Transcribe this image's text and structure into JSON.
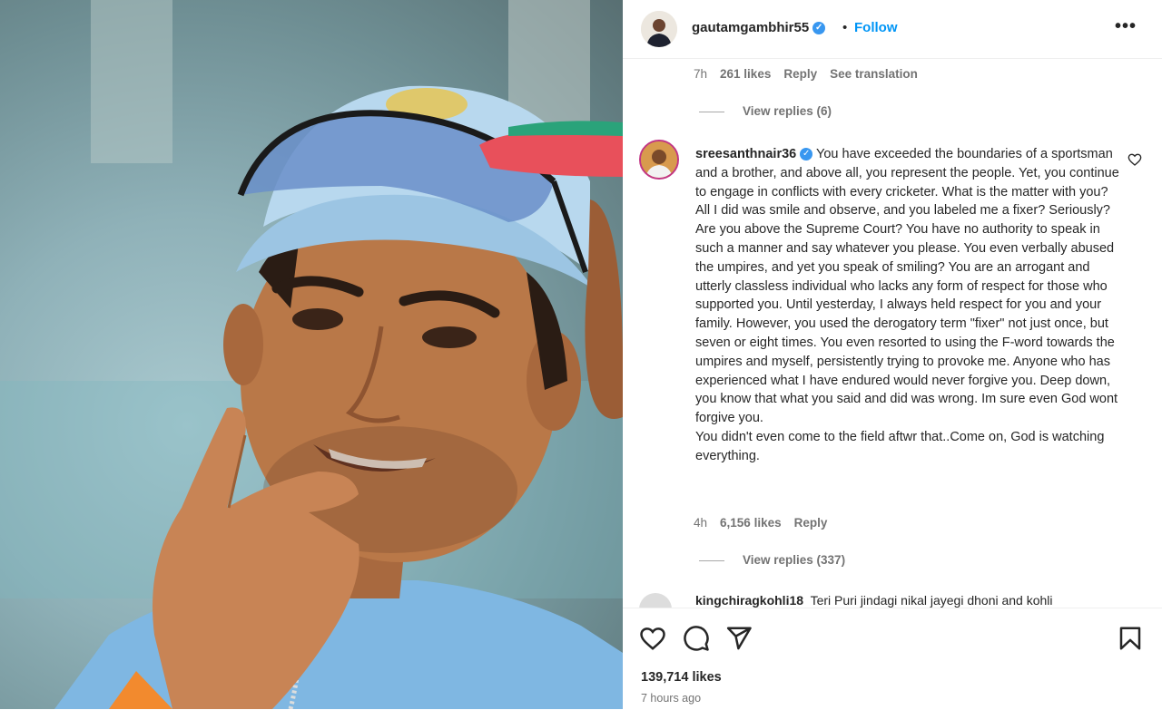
{
  "header": {
    "username": "gautamgambhir55",
    "dot": "•",
    "follow_label": "Follow",
    "more_label": "•••"
  },
  "comment1": {
    "time": "7h",
    "likes": "261 likes",
    "reply": "Reply",
    "see_translation": "See translation",
    "view_replies": "View replies (6)"
  },
  "comment2": {
    "username": "sreesanthnair36",
    "text": "You have exceeded the boundaries of a sportsman and a brother, and above all, you represent the people. Yet, you continue to engage in conflicts with every cricketer. What is the matter with you? All I did was smile and observe, and you labeled me a fixer? Seriously? Are you above the Supreme Court? You have no authority to speak in such a manner and say whatever you please. You even verbally abused the umpires, and yet you speak of smiling? You are an arrogant and utterly classless individual who lacks any form of respect for those who supported you. Until yesterday, I always held respect for you and your family. However, you used the derogatory term \"fixer\" not just once, but seven or eight times. You even resorted to using the F-word towards the umpires and myself, persistently trying to provoke me. Anyone who has experienced what I have endured would never forgive you. Deep down, you know that what you said and did was wrong. Im sure even God wont forgive you.",
    "text2": "You didn't even come to the field aftwr that..Come on, God is watching everything.",
    "time": "4h",
    "likes": "6,156 likes",
    "reply": "Reply",
    "view_replies": "View replies (337)"
  },
  "comment3": {
    "username": "kingchiragkohli18",
    "text": "Teri Puri jindagi nikal jayegi dhoni and kohli"
  },
  "post": {
    "likes": "139,714 likes",
    "time_ago": "7 hours ago"
  },
  "icons": {
    "verified": "verified-badge-icon",
    "heart": "heart-icon",
    "comment": "comment-icon",
    "share": "share-icon",
    "save": "bookmark-icon"
  },
  "colors": {
    "accent": "#0095f6",
    "verified": "#3897f0",
    "secondary_text": "#737373"
  }
}
